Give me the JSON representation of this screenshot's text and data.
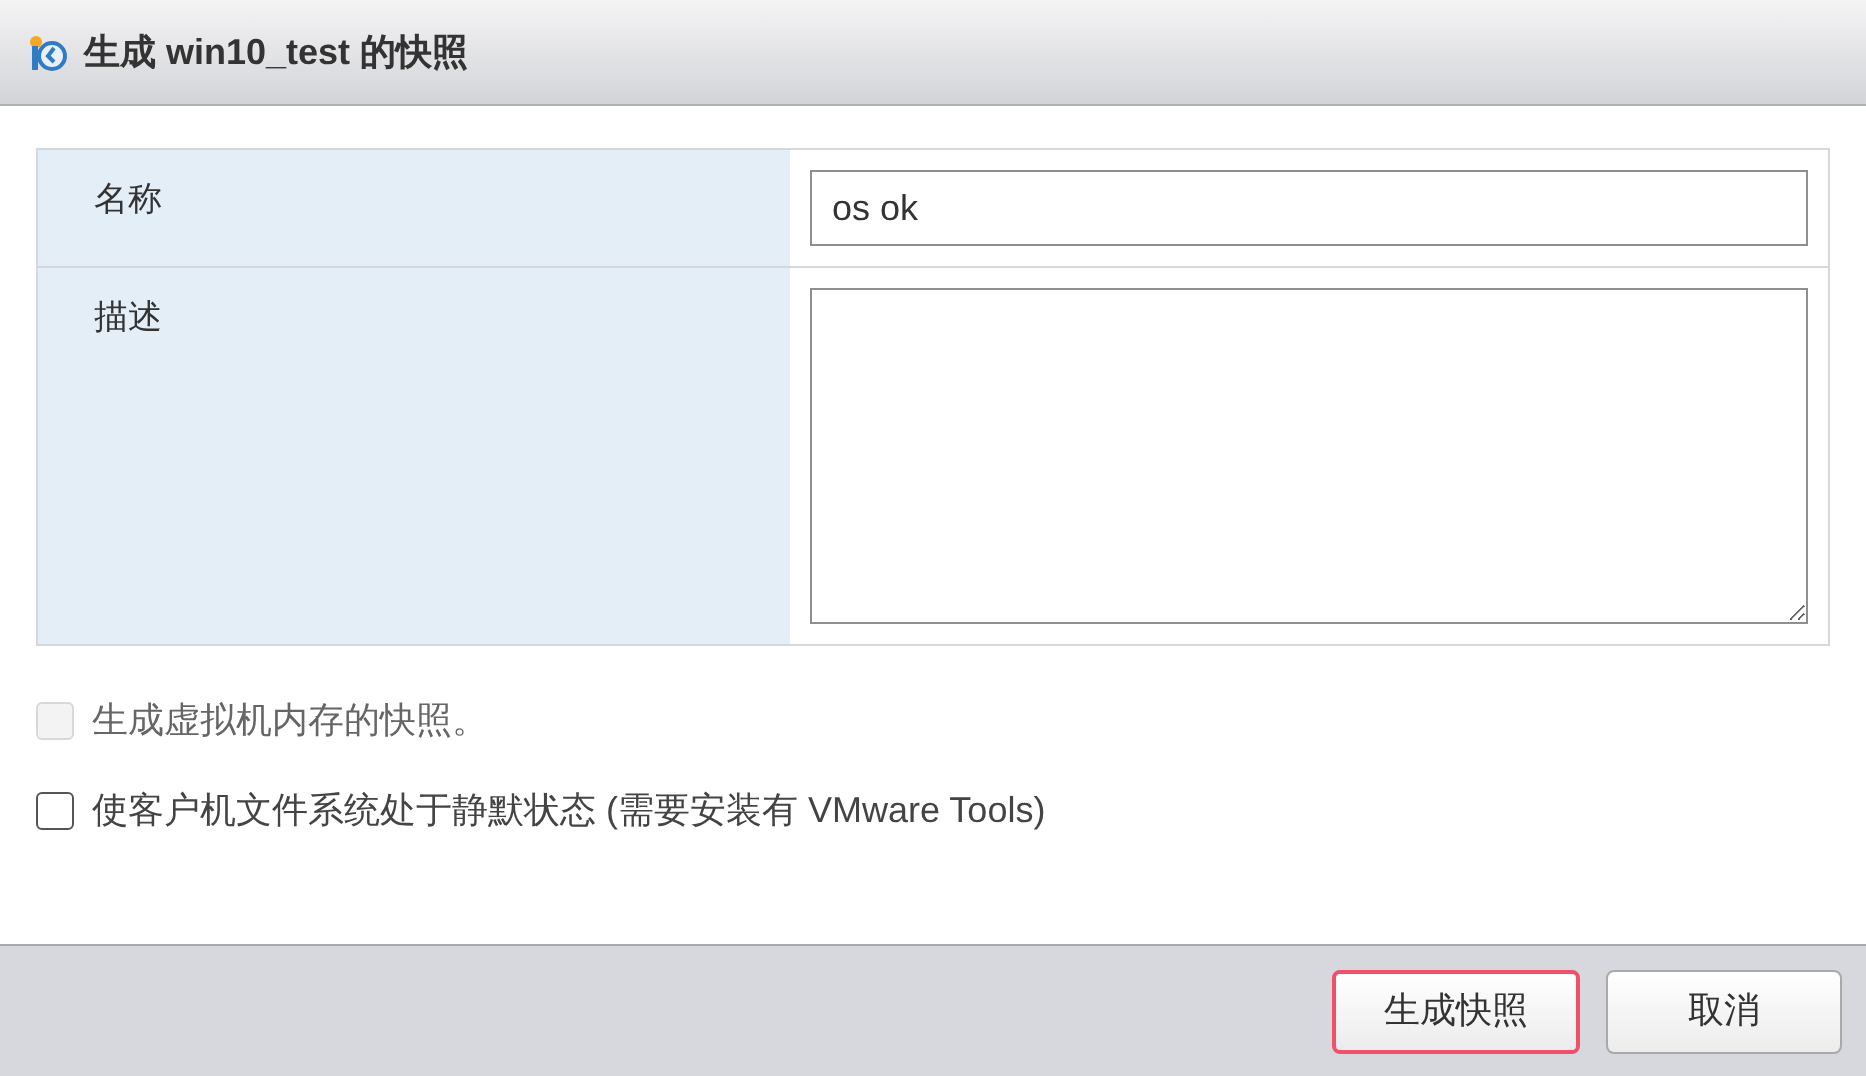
{
  "window": {
    "title": "生成 win10_test 的快照"
  },
  "form": {
    "rows": [
      {
        "kind": "input",
        "label": "名称",
        "value": "os ok"
      },
      {
        "kind": "textarea",
        "label": "描述",
        "value": ""
      }
    ]
  },
  "options": [
    {
      "label": "生成虚拟机内存的快照。",
      "checked": false,
      "disabled": true
    },
    {
      "label": "使客户机文件系统处于静默状态 (需要安装有 VMware Tools)",
      "checked": false,
      "disabled": false
    }
  ],
  "buttons": [
    {
      "label": "生成快照",
      "highlighted": true
    },
    {
      "label": "取消",
      "highlighted": false
    }
  ]
}
